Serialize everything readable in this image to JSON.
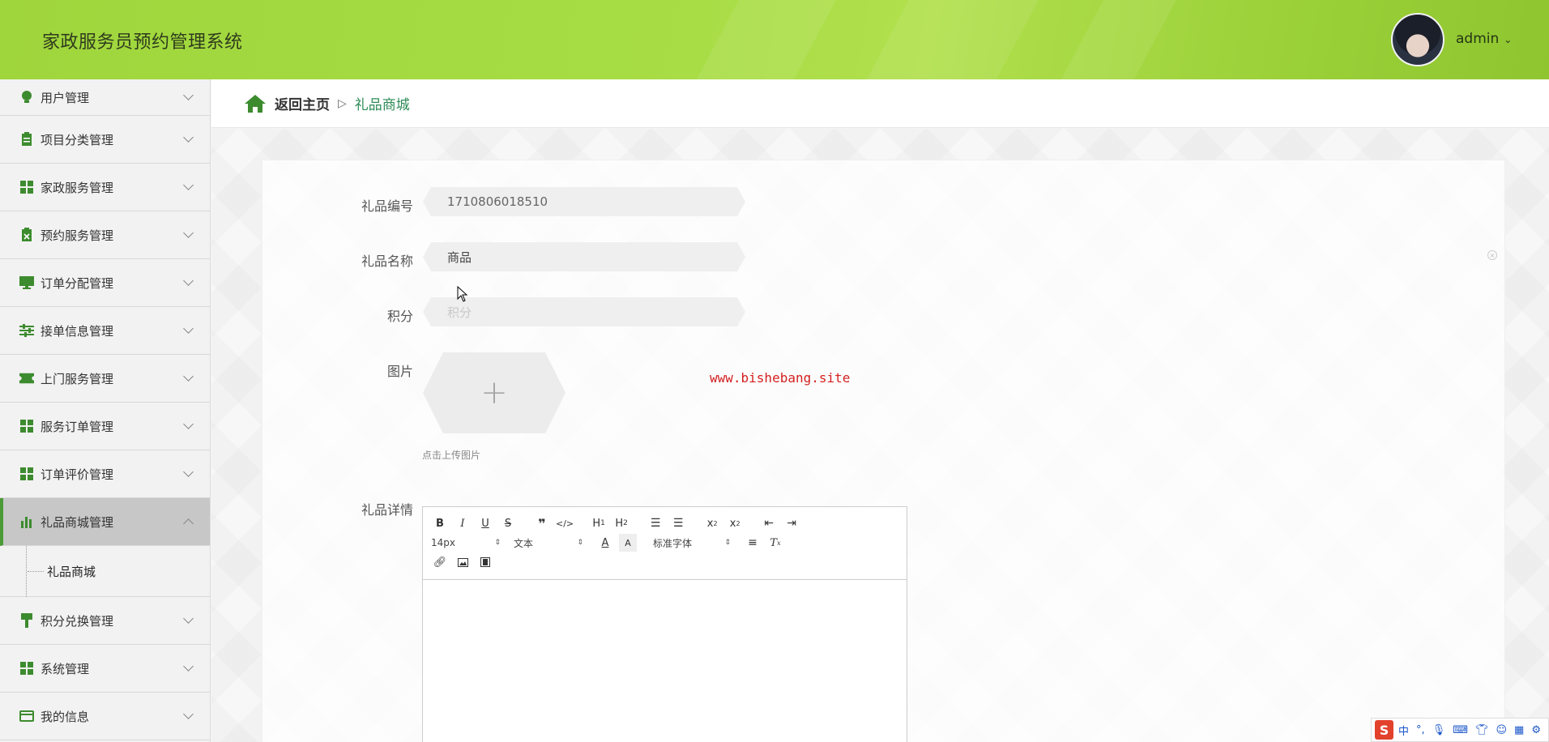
{
  "header": {
    "title": "家政服务员预约管理系统",
    "username": "admin"
  },
  "sidebar": {
    "items": [
      {
        "label": "用户管理",
        "icon": "lightbulb-icon"
      },
      {
        "label": "项目分类管理",
        "icon": "clipboard-icon"
      },
      {
        "label": "家政服务管理",
        "icon": "grid-icon"
      },
      {
        "label": "预约服务管理",
        "icon": "clipboard-x-icon"
      },
      {
        "label": "订单分配管理",
        "icon": "monitor-icon"
      },
      {
        "label": "接单信息管理",
        "icon": "sliders-icon"
      },
      {
        "label": "上门服务管理",
        "icon": "ticket-icon"
      },
      {
        "label": "服务订单管理",
        "icon": "grid-icon"
      },
      {
        "label": "订单评价管理",
        "icon": "grid-icon"
      },
      {
        "label": "礼品商城管理",
        "icon": "bar-chart-icon",
        "active": true
      },
      {
        "label": "积分兑换管理",
        "icon": "brush-icon"
      },
      {
        "label": "系统管理",
        "icon": "grid-icon"
      },
      {
        "label": "我的信息",
        "icon": "wallet-icon"
      }
    ],
    "submenu_label": "礼品商城"
  },
  "breadcrumb": {
    "home": "返回主页",
    "separator": "▷",
    "current": "礼品商城"
  },
  "form": {
    "gift_no_label": "礼品编号",
    "gift_no_value": "1710806018510",
    "gift_name_label": "礼品名称",
    "gift_name_value": "商品",
    "points_label": "积分",
    "points_placeholder": "积分",
    "image_label": "图片",
    "upload_tip": "点击上传图片",
    "detail_label": "礼品详情"
  },
  "editor": {
    "font_size": "14px",
    "paragraph": "文本",
    "font_family": "标准字体"
  },
  "watermark": "www.bishebang.site",
  "ime": {
    "lang": "中",
    "logo": "S"
  },
  "colors": {
    "header_green": "#a6dc44",
    "accent_green": "#4a9a36",
    "breadcrumb_current": "#2e8b57",
    "watermark_red": "#d42020"
  }
}
